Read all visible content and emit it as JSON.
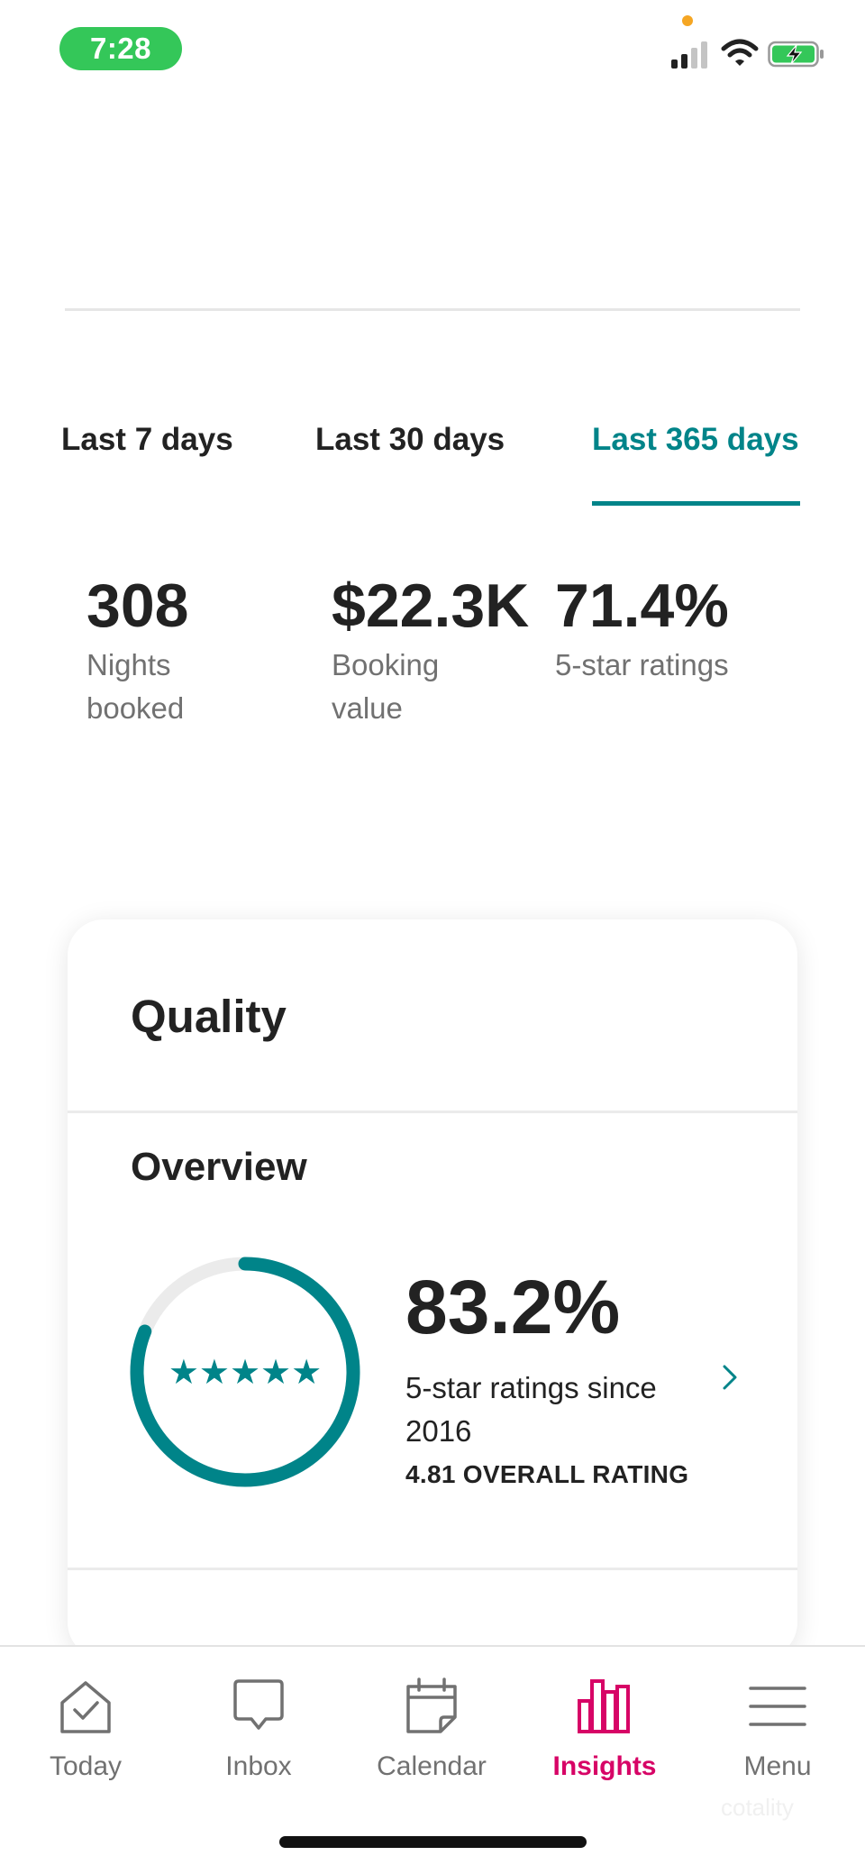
{
  "status_bar": {
    "time": "7:28"
  },
  "tabs": [
    {
      "label": "Last 7 days",
      "selected": false
    },
    {
      "label": "Last 30 days",
      "selected": false
    },
    {
      "label": "Last 365 days",
      "selected": true
    }
  ],
  "stats": [
    {
      "value": "308",
      "label": "Nights booked"
    },
    {
      "value": "$22.3K",
      "label": "Booking value"
    },
    {
      "value": "71.4%",
      "label": "5-star ratings"
    }
  ],
  "quality": {
    "title": "Quality",
    "overview": {
      "title": "Overview",
      "stars": "★★★★★",
      "percent_text": "83.2%",
      "percent_value": 83.2,
      "label": "5-star ratings since 2016",
      "overall": "4.81 OVERALL RATING"
    }
  },
  "bottom_nav": [
    {
      "label": "Today",
      "icon": "house-check-icon",
      "active": false
    },
    {
      "label": "Inbox",
      "icon": "chat-bubble-icon",
      "active": false
    },
    {
      "label": "Calendar",
      "icon": "calendar-icon",
      "active": false
    },
    {
      "label": "Insights",
      "icon": "bar-chart-icon",
      "active": true
    },
    {
      "label": "Menu",
      "icon": "hamburger-menu-icon",
      "active": false
    }
  ],
  "watermark": "cotality",
  "colors": {
    "accent_teal": "#008489",
    "active_pink": "#d70466",
    "text_primary": "#222222",
    "text_secondary": "#717171",
    "time_pill_green": "#34c759"
  }
}
